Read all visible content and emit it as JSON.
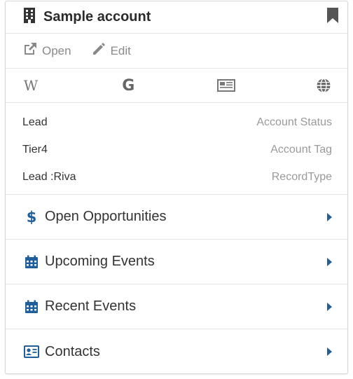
{
  "header": {
    "title": "Sample account",
    "icon": "building-icon",
    "bookmark_icon": "bookmark-icon"
  },
  "actions": [
    {
      "label": "Open",
      "icon": "external-link-icon"
    },
    {
      "label": "Edit",
      "icon": "pencil-icon"
    }
  ],
  "links": [
    {
      "name": "wikipedia-icon",
      "glyph": "W"
    },
    {
      "name": "google-icon",
      "glyph": "G"
    },
    {
      "name": "news-icon"
    },
    {
      "name": "globe-icon"
    }
  ],
  "fields": [
    {
      "value": "Lead",
      "key": "Account Status"
    },
    {
      "value": "Tier4",
      "key": "Account Tag"
    },
    {
      "value": "Lead :Riva",
      "key": "RecordType"
    }
  ],
  "sections": [
    {
      "label": "Open Opportunities",
      "icon": "dollar-icon"
    },
    {
      "label": "Upcoming Events",
      "icon": "calendar-icon"
    },
    {
      "label": "Recent Events",
      "icon": "calendar-icon"
    },
    {
      "label": "Contacts",
      "icon": "contact-card-icon"
    }
  ],
  "colors": {
    "accent": "#1f5f9e",
    "muted": "#8a8a8a",
    "dark": "#333333"
  }
}
